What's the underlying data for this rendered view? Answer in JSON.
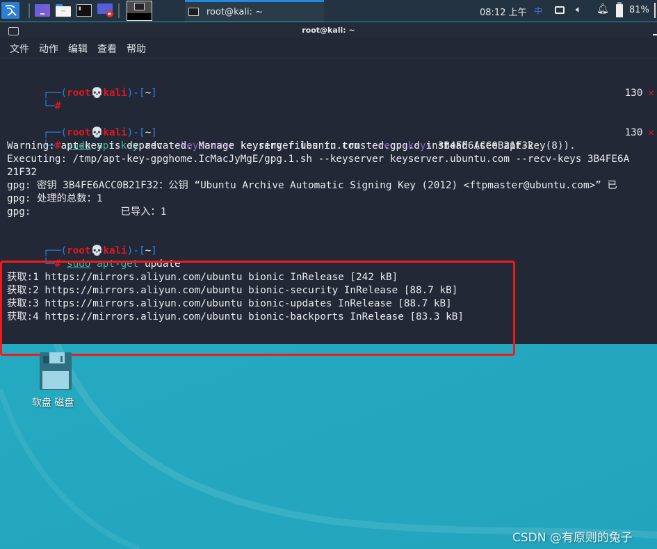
{
  "panel": {
    "apps": [
      {
        "name": "kali-menu",
        "icon": "kali-dragon-icon"
      },
      {
        "name": "workspace-switcher-app",
        "icon": "purple-window-icon"
      },
      {
        "name": "file-manager",
        "icon": "folder-icon"
      },
      {
        "name": "terminal",
        "icon": "terminal-icon"
      },
      {
        "name": "screen-recorder",
        "icon": "screen-record-icon"
      }
    ],
    "workspace": {
      "active": 1
    },
    "taskbar_window_label": "root@kali: ~",
    "clock": "08:12 上午",
    "ime_indicator": "中",
    "battery_percent": "81%"
  },
  "terminal": {
    "title": "root@kali: ~",
    "menu": [
      "文件",
      "动作",
      "编辑",
      "查看",
      "帮助"
    ],
    "prompt": {
      "open": "┌──(",
      "user": "root",
      "skull": "💀",
      "host": "kali",
      "close": ")-[",
      "dir": "~",
      "end": "]",
      "hash_prefix": "└─",
      "hash": "#"
    },
    "blocks": [
      {
        "command": {
          "sudo": "",
          "cmd": "",
          "args": []
        },
        "status_code": "130",
        "status_icon": "✕"
      },
      {
        "command": {
          "sudo": "sudo",
          "cmd": "apt-key",
          "arg1": "adv",
          "opt1": "--keyserver",
          "arg2": "keyserver.ubuntu.com",
          "opt2": "--recv-keys",
          "arg3": "3B4FE6ACC0B21F32"
        },
        "status_code": "130",
        "status_icon": "✕",
        "output": [
          "Warning: apt-key is deprecated. Manage keyring files in trusted.gpg.d instead (see apt-key(8)).",
          "Executing: /tmp/apt-key-gpghome.IcMacJyMgE/gpg.1.sh --keyserver keyserver.ubuntu.com --recv-keys 3B4FE6A",
          "21F32",
          "gpg: 密钥 3B4FE6ACC0B21F32：公钥 “Ubuntu Archive Automatic Signing Key (2012) <ftpmaster@ubuntu.com>” 已",
          "gpg: 处理的总数：1",
          "gpg:               已导入：1"
        ]
      },
      {
        "command": {
          "sudo": "sudo",
          "cmd": "apt-get",
          "arg1": "update"
        },
        "output": [
          "获取:1 https://mirrors.aliyun.com/ubuntu bionic InRelease [242 kB]",
          "获取:2 https://mirrors.aliyun.com/ubuntu bionic-security InRelease [88.7 kB]",
          "获取:3 https://mirrors.aliyun.com/ubuntu bionic-updates InRelease [88.7 kB]",
          "获取:4 https://mirrors.aliyun.com/ubuntu bionic-backports InRelease [83.3 kB]"
        ]
      }
    ]
  },
  "desktop": {
    "icons": [
      {
        "label": "软盘 磁盘",
        "icon": "floppy-disk-icon"
      }
    ],
    "watermark": "CSDN @有原则的兔子"
  },
  "colors": {
    "prompt_red": "#e0171e",
    "prompt_blue": "#2f7fdc",
    "command_green": "#4ab59c",
    "option_purple": "#8a66c9",
    "terminal_bg": "#232836",
    "panel_bg": "#233341",
    "highlight_red": "#f01c1c",
    "desktop_teal": "#24aac0"
  }
}
